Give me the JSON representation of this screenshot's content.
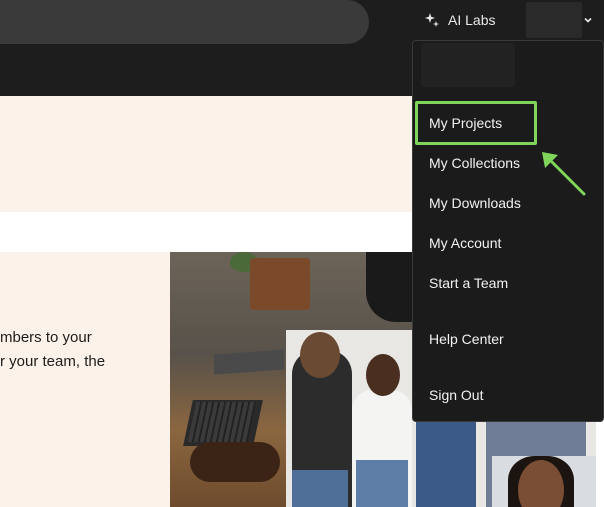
{
  "header": {
    "ai_labs_label": "AI Labs",
    "ai_labs_icon": "sparkle-icon",
    "account_caret_icon": "chevron-down-icon"
  },
  "hero": {
    "body_line_1": "mbers to your",
    "body_line_2": "r your team, the"
  },
  "account_menu": {
    "items": [
      {
        "label": "My Projects",
        "highlighted": true
      },
      {
        "label": "My Collections"
      },
      {
        "label": "My Downloads"
      },
      {
        "label": "My Account"
      },
      {
        "label": "Start a Team"
      },
      {
        "label": "Help Center"
      },
      {
        "label": "Sign Out"
      }
    ]
  },
  "annotation": {
    "highlight_color": "#7fd65a",
    "arrow_icon": "arrow-up-left-icon"
  },
  "colors": {
    "header_bg": "#1d1d1d",
    "menu_bg": "#1b1b1b",
    "hero_bg": "#fdf2ea",
    "accent_green": "#7fd65a"
  }
}
